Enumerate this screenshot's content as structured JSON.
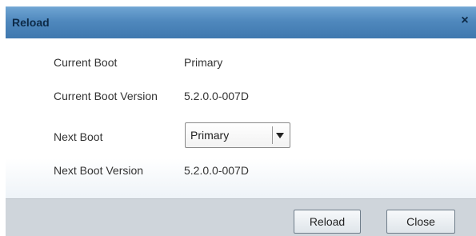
{
  "dialog": {
    "title": "Reload",
    "close_glyph": "×"
  },
  "fields": {
    "current_boot_label": "Current Boot",
    "current_boot_value": "Primary",
    "current_boot_version_label": "Current Boot Version",
    "current_boot_version_value": "5.2.0.0-007D",
    "next_boot_label": "Next Boot",
    "next_boot_selected": "Primary",
    "next_boot_version_label": "Next Boot Version",
    "next_boot_version_value": "5.2.0.0-007D"
  },
  "footer": {
    "reload_label": "Reload",
    "close_label": "Close"
  },
  "colors": {
    "titlebar": "#4f88bd",
    "footer": "#cfd5db"
  }
}
